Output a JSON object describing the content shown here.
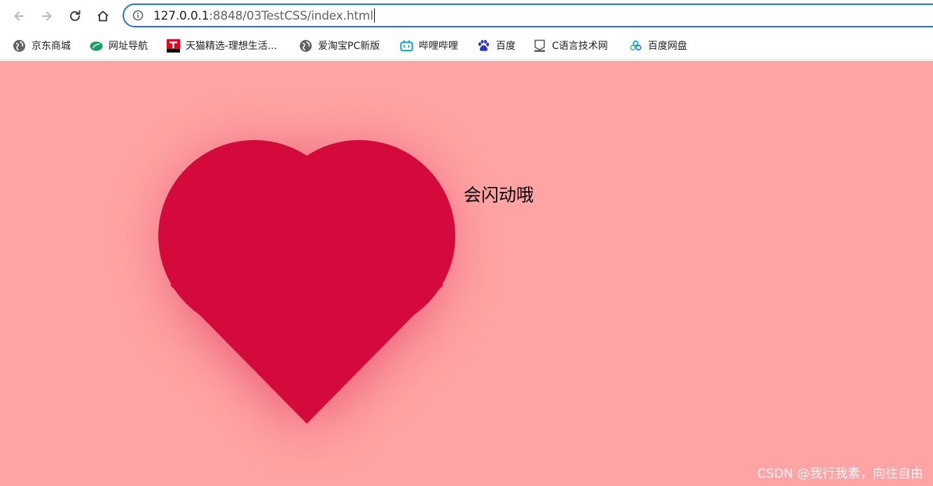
{
  "browser": {
    "url_host": "127.0.0.1",
    "url_rest": ":8848/03TestCSS/index.html",
    "accent": "#1a73e8"
  },
  "toolbar": {
    "back_icon": "arrow-left-icon",
    "forward_icon": "arrow-right-icon",
    "reload_icon": "reload-icon",
    "home_icon": "home-icon",
    "info_icon": "info-icon"
  },
  "bookmarks": [
    {
      "label": "京东商城",
      "icon": "globe-icon"
    },
    {
      "label": "网址导航",
      "icon": "leaf-icon"
    },
    {
      "label": "天猫精选-理想生活...",
      "icon": "tmall-icon"
    },
    {
      "label": "爱淘宝PC新版",
      "icon": "globe-icon"
    },
    {
      "label": "哔哩哔哩",
      "icon": "bilibili-icon"
    },
    {
      "label": "百度",
      "icon": "baidu-paw-icon"
    },
    {
      "label": "C语言技术网",
      "icon": "shield-icon"
    },
    {
      "label": "百度网盘",
      "icon": "cloud-icon"
    }
  ],
  "page": {
    "background": "#fea4a4",
    "heart_color": "#d40a3c",
    "flash_text": "会闪动哦",
    "watermark": "CSDN @我行我素，向往自由"
  }
}
